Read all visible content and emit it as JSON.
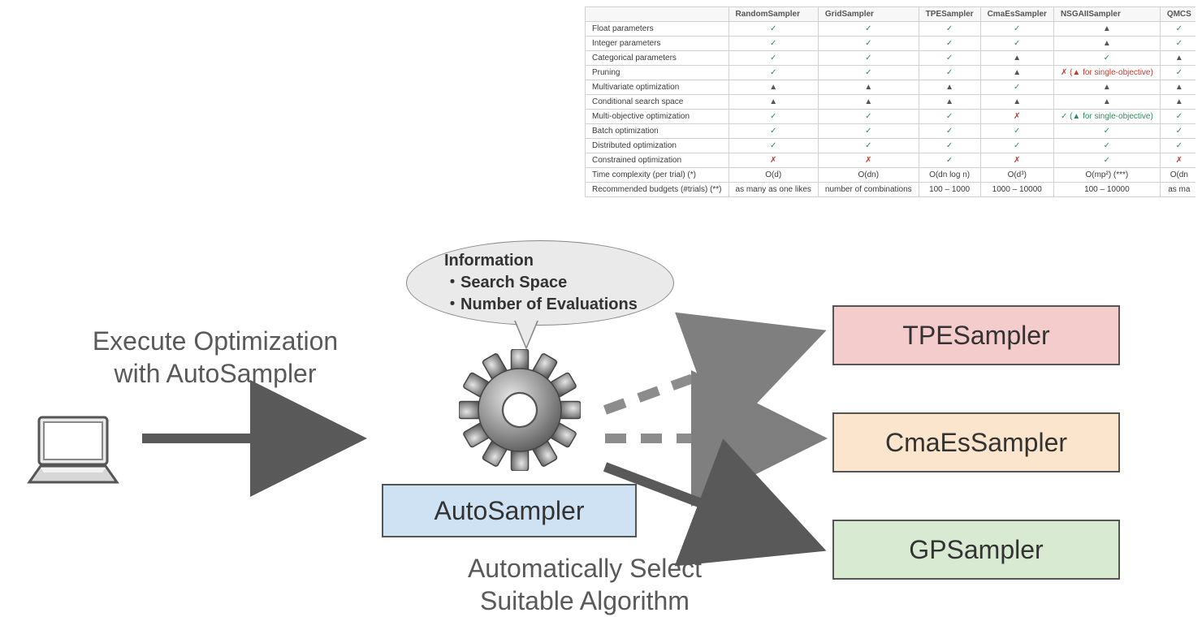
{
  "captions": {
    "exec_line1": "Execute Optimization",
    "exec_line2": "with AutoSampler",
    "select_line1": "Automatically Select",
    "select_line2": "Suitable Algorithm"
  },
  "bubble": {
    "title": "Information",
    "line1": "・Search Space",
    "line2": "・Number of Evaluations"
  },
  "boxes": {
    "auto": "AutoSampler",
    "tpe": "TPESampler",
    "cmaes": "CmaEsSampler",
    "gp": "GPSampler"
  },
  "table": {
    "headers": [
      "",
      "RandomSampler",
      "GridSampler",
      "TPESampler",
      "CmaEsSampler",
      "NSGAIISampler",
      "QMCS"
    ],
    "rows": [
      {
        "label": "Float parameters",
        "cells": [
          "✓",
          "✓",
          "✓",
          "✓",
          "▲",
          "✓"
        ],
        "cls": [
          "chk",
          "chk",
          "chk",
          "chk",
          "tri",
          "chk"
        ]
      },
      {
        "label": "Integer parameters",
        "cells": [
          "✓",
          "✓",
          "✓",
          "✓",
          "▲",
          "✓"
        ],
        "cls": [
          "chk",
          "chk",
          "chk",
          "chk",
          "tri",
          "chk"
        ]
      },
      {
        "label": "Categorical parameters",
        "cells": [
          "✓",
          "✓",
          "✓",
          "▲",
          "✓",
          "▲"
        ],
        "cls": [
          "chk",
          "chk",
          "chk",
          "tri",
          "chk",
          "tri"
        ]
      },
      {
        "label": "Pruning",
        "cells": [
          "✓",
          "✓",
          "✓",
          "▲",
          "✗ (▲ for single-objective)",
          "✓"
        ],
        "cls": [
          "chk",
          "chk",
          "chk",
          "tri",
          "na",
          "chk"
        ]
      },
      {
        "label": "Multivariate optimization",
        "cells": [
          "▲",
          "▲",
          "▲",
          "✓",
          "▲",
          "▲"
        ],
        "cls": [
          "tri",
          "tri",
          "tri",
          "chk",
          "tri",
          "tri"
        ]
      },
      {
        "label": "Conditional search space",
        "cells": [
          "▲",
          "▲",
          "▲",
          "▲",
          "▲",
          "▲"
        ],
        "cls": [
          "tri",
          "tri",
          "tri",
          "tri",
          "tri",
          "tri"
        ]
      },
      {
        "label": "Multi-objective optimization",
        "cells": [
          "✓",
          "✓",
          "✓",
          "✗",
          "✓ (▲ for single-objective)",
          "✓"
        ],
        "cls": [
          "chk",
          "chk",
          "chk",
          "na",
          "chk",
          "chk"
        ]
      },
      {
        "label": "Batch optimization",
        "cells": [
          "✓",
          "✓",
          "✓",
          "✓",
          "✓",
          "✓"
        ],
        "cls": [
          "chk",
          "chk",
          "chk",
          "chk",
          "chk",
          "chk"
        ]
      },
      {
        "label": "Distributed optimization",
        "cells": [
          "✓",
          "✓",
          "✓",
          "✓",
          "✓",
          "✓"
        ],
        "cls": [
          "chk",
          "chk",
          "chk",
          "chk",
          "chk",
          "chk"
        ]
      },
      {
        "label": "Constrained optimization",
        "cells": [
          "✗",
          "✗",
          "✓",
          "✗",
          "✓",
          "✗"
        ],
        "cls": [
          "na",
          "na",
          "chk",
          "na",
          "chk",
          "na"
        ]
      },
      {
        "label": "Time complexity (per trial) (*)",
        "cells": [
          "O(d)",
          "O(dn)",
          "O(dn log n)",
          "O(d³)",
          "O(mp²) (***)",
          "O(dn"
        ],
        "cls": [
          "",
          "",
          "",
          "",
          "",
          ""
        ]
      },
      {
        "label": "Recommended budgets (#trials) (**)",
        "cells": [
          "as many as one likes",
          "number of combinations",
          "100 – 1000",
          "1000 – 10000",
          "100 – 10000",
          "as ma"
        ],
        "cls": [
          "",
          "",
          "",
          "",
          "",
          ""
        ]
      }
    ]
  }
}
